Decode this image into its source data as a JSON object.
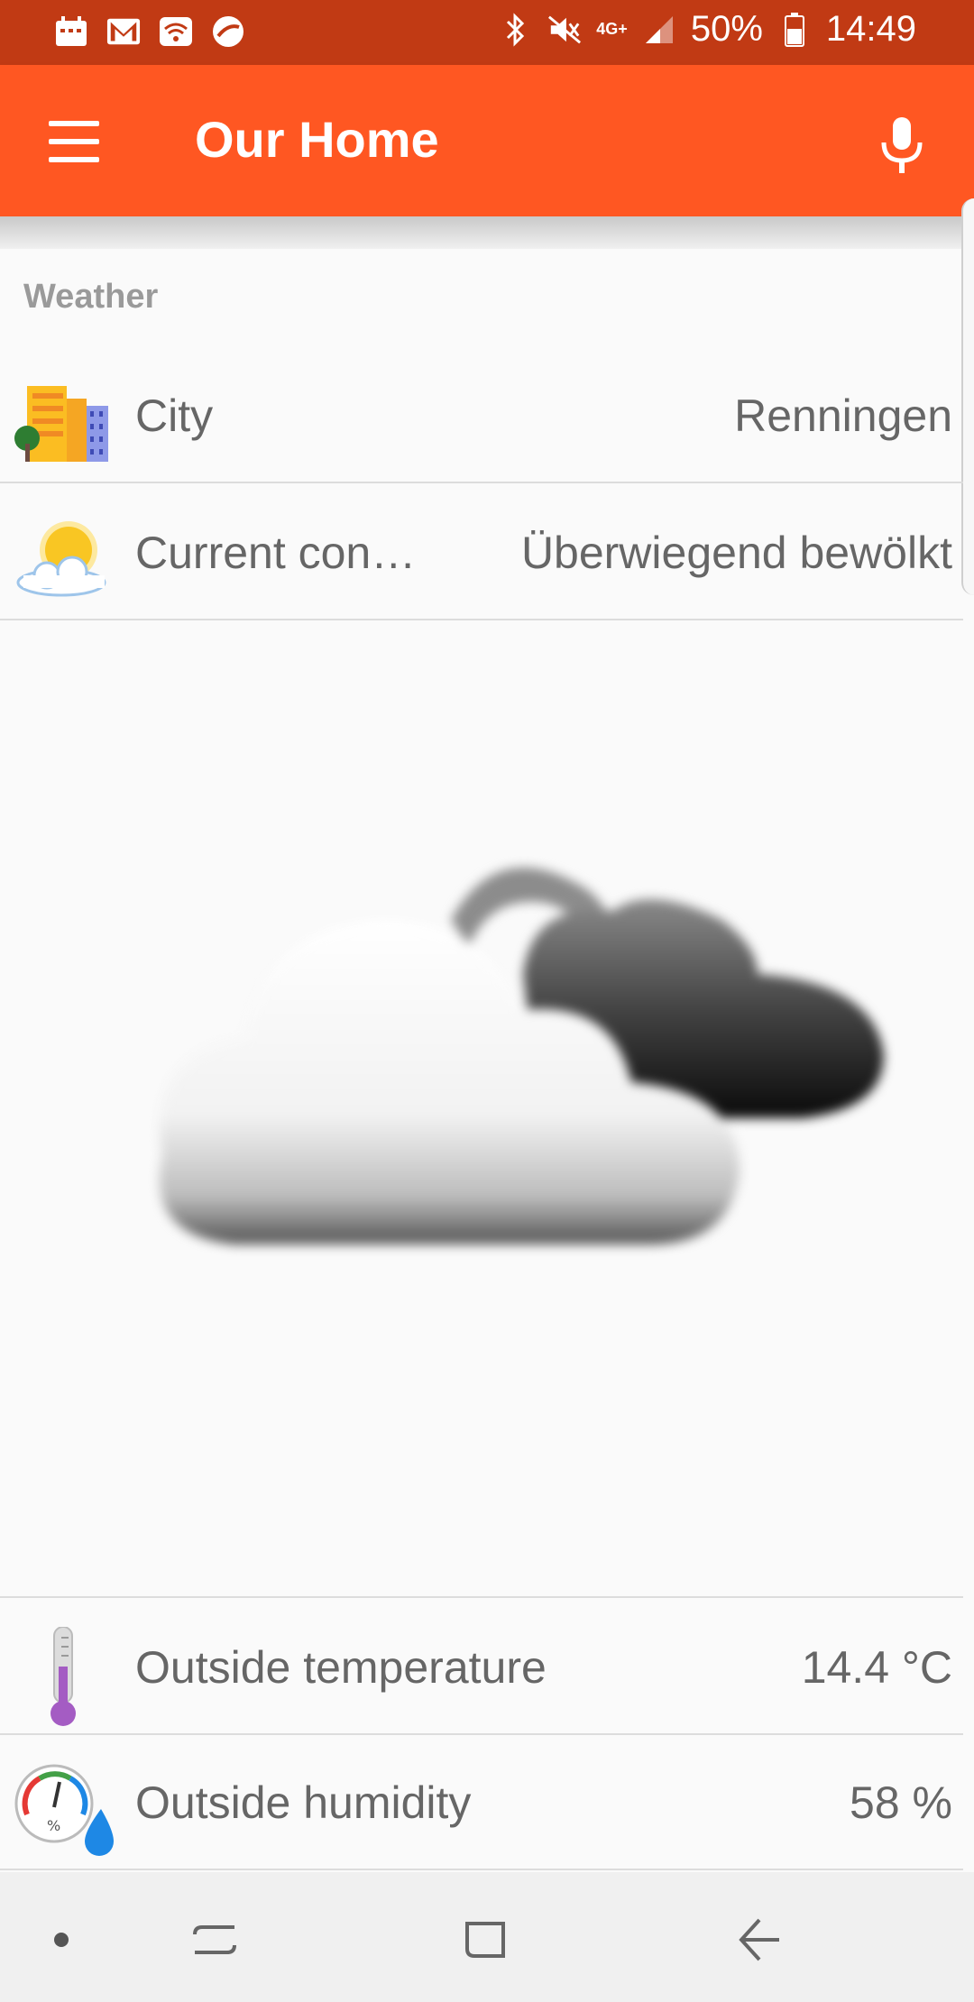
{
  "status_bar": {
    "battery": "50%",
    "time": "14:49",
    "network": "4G+"
  },
  "app_bar": {
    "title": "Our Home"
  },
  "weather": {
    "section_header": "Weather",
    "rows": [
      {
        "label": "City",
        "value": "Renningen",
        "icon": "city-buildings-icon"
      },
      {
        "label": "Current con…",
        "value": "Überwiegend bewölkt",
        "icon": "partly-sunny-icon"
      }
    ],
    "large_icon": "cloudy-weather-icon"
  },
  "sensors": [
    {
      "label": "Outside temperature",
      "value": "14.4 °C",
      "icon": "thermometer-icon"
    },
    {
      "label": "Outside humidity",
      "value": "58 %",
      "icon": "humidity-gauge-icon"
    }
  ],
  "colors": {
    "status_bar": "#c13a14",
    "app_bar": "#ff5722",
    "background": "#fafafa"
  }
}
